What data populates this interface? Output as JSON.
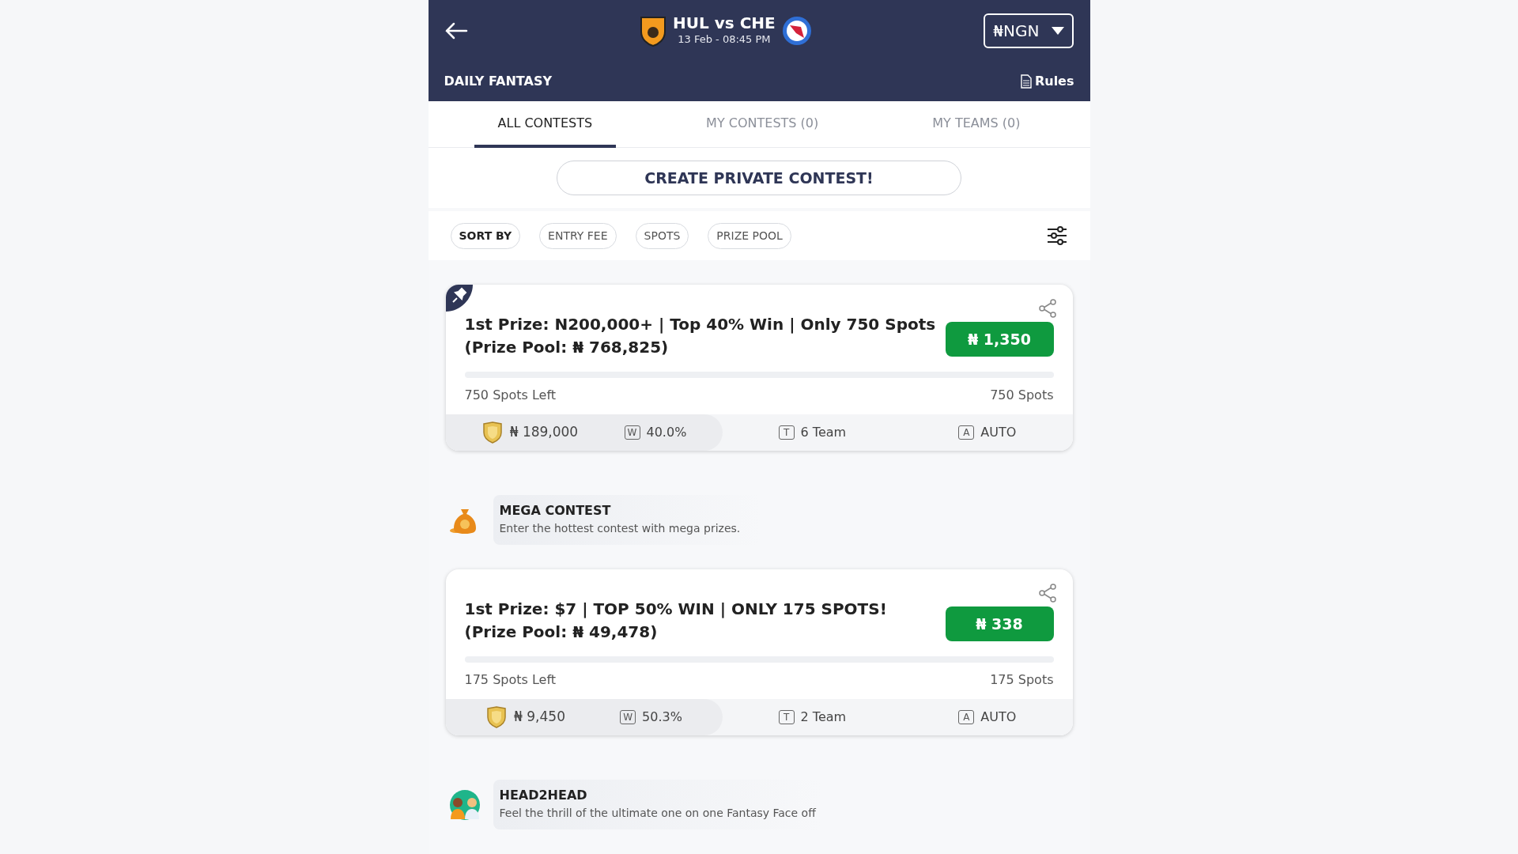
{
  "header": {
    "match_title": "HUL vs CHE",
    "match_time": "13 Feb - 08:45 PM",
    "currency": "₦NGN",
    "section_title": "DAILY FANTASY",
    "rules_link": "Rules"
  },
  "tabs": [
    {
      "label": "ALL CONTESTS",
      "selected": true
    },
    {
      "label": "MY CONTESTS (0)",
      "selected": false
    },
    {
      "label": "MY TEAMS (0)",
      "selected": false
    }
  ],
  "create_button": "CREATE PRIVATE CONTEST!",
  "sort": {
    "label": "SORT BY",
    "options": [
      "ENTRY FEE",
      "SPOTS",
      "PRIZE POOL"
    ]
  },
  "feed": [
    {
      "kind": "contest",
      "pinned": true,
      "title_lines": [
        "1st Prize: N200,000+ | Top 40% Win | Only 750 Spots",
        "(Prize Pool: ₦ 768,825)"
      ],
      "entry_fee": "₦ 1,350",
      "level": 0,
      "spots_left": "750 Spots Left",
      "total_spots": "750 Spots",
      "first_prize": "₦ 189,000",
      "win_badge": "W",
      "win_pct": "40.0%",
      "team_badge": "T",
      "teams": "6 Team",
      "mode_badge": "A",
      "mode": "AUTO"
    },
    {
      "kind": "category",
      "title": "MEGA CONTEST",
      "subtitle": "Enter the hottest contest with mega prizes."
    },
    {
      "kind": "contest",
      "pinned": false,
      "title_lines": [
        "1st Prize: $7 | TOP 50% WIN | ONLY 175 SPOTS!",
        "(Prize Pool: ₦ 49,478)"
      ],
      "entry_fee": "₦ 338",
      "level": 0,
      "spots_left": "175 Spots Left",
      "total_spots": "175 Spots",
      "first_prize": "₦ 9,450",
      "win_badge": "W",
      "win_pct": "50.3%",
      "team_badge": "T",
      "teams": "2 Team",
      "mode_badge": "A",
      "mode": "AUTO"
    },
    {
      "kind": "category",
      "title": "HEAD2HEAD",
      "subtitle": "Feel the thrill of the ultimate one on one Fantasy Face off"
    }
  ]
}
